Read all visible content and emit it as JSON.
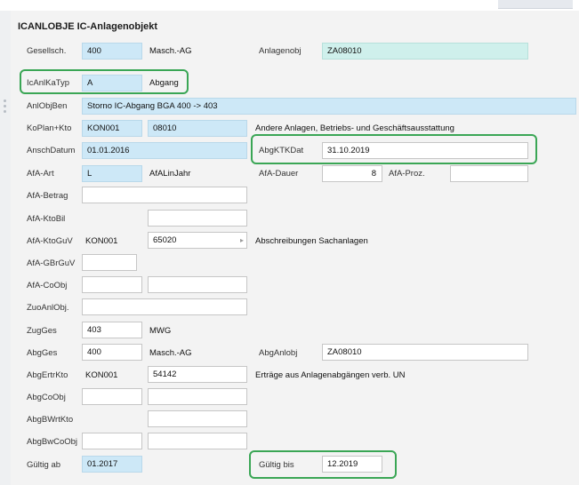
{
  "header": {
    "title": "ICANLOBJE IC-Anlagenobjekt"
  },
  "rows": {
    "gesellsch": {
      "label": "Gesellsch.",
      "value": "400",
      "text": "Masch.-AG",
      "anlagenobj_label": "Anlagenobj",
      "anlagenobj_value": "ZA08010"
    },
    "icanlkatyp": {
      "label": "IcAnlKaTyp",
      "value": "A",
      "text": "Abgang"
    },
    "anlobjben": {
      "label": "AnlObjBen",
      "value": "Storno IC-Abgang BGA 400 -> 403"
    },
    "koplan": {
      "label": "KoPlan+Kto",
      "value1": "KON001",
      "value2": "08010",
      "text": "Andere Anlagen, Betriebs- und Geschäftsausstattung"
    },
    "anschdatum": {
      "label": "AnschDatum",
      "value": "01.01.2016",
      "abgktkdat_label": "AbgKTKDat",
      "abgktkdat_value": "31.10.2019"
    },
    "afaart": {
      "label": "AfA-Art",
      "value": "L",
      "text": "AfALinJahr",
      "dauer_label": "AfA-Dauer",
      "dauer_value": "8",
      "proz_label": "AfA-Proz.",
      "proz_value": ""
    },
    "afabetrag": {
      "label": "AfA-Betrag",
      "value": ""
    },
    "afaktobil": {
      "label": "AfA-KtoBil",
      "value": ""
    },
    "afaktoguv": {
      "label": "AfA-KtoGuV",
      "value1": "KON001",
      "value2": "65020",
      "text": "Abschreibungen Sachanlagen"
    },
    "afagbrguv": {
      "label": "AfA-GBrGuV",
      "value": ""
    },
    "afacoobj": {
      "label": "AfA-CoObj",
      "value1": "",
      "value2": ""
    },
    "zuoanlobj": {
      "label": "ZuoAnlObj.",
      "value": ""
    },
    "zugges": {
      "label": "ZugGes",
      "value": "403",
      "text": "MWG"
    },
    "abgges": {
      "label": "AbgGes",
      "value": "400",
      "text": "Masch.-AG",
      "abganlobj_label": "AbgAnlobj",
      "abganlobj_value": "ZA08010"
    },
    "abgertrkto": {
      "label": "AbgErtrKto",
      "value1": "KON001",
      "value2": "54142",
      "text": "Erträge aus Anlagenabgängen verb. UN"
    },
    "abgcoobj": {
      "label": "AbgCoObj",
      "value1": "",
      "value2": ""
    },
    "abgbwrtkto": {
      "label": "AbgBWrtKto",
      "value": ""
    },
    "abgbwcoobj": {
      "label": "AbgBwCoObj",
      "value1": "",
      "value2": ""
    },
    "gueltigab": {
      "label": "Gültig ab",
      "value": "01.2017",
      "gueltigbis_label": "Gültig bis",
      "gueltigbis_value": "12.2019"
    }
  },
  "icons": {
    "field_arrow": "chevron-right-icon"
  },
  "colors": {
    "highlight": "#3aa655",
    "readonly_field": "#cde8f7",
    "key_field": "#cff0ec",
    "panel_bg": "#f3f3f3"
  }
}
